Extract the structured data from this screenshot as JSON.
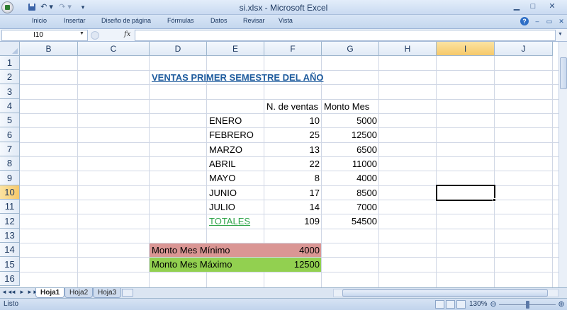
{
  "window": {
    "title": "si.xlsx - Microsoft Excel",
    "qat_undo": "↶ ▾",
    "qat_redo": "↷ ▾",
    "qat_more": "▾",
    "min": "▁",
    "max": "□",
    "close": "✕"
  },
  "ribbon": {
    "tabs": [
      "Inicio",
      "Insertar",
      "Diseño de página",
      "Fórmulas",
      "Datos",
      "Revisar",
      "Vista"
    ],
    "help": "?",
    "min": "–",
    "max": "▭",
    "close": "✕"
  },
  "formula_bar": {
    "name_box": "I10",
    "fx": "fx",
    "formula": ""
  },
  "sheet": {
    "columns": [
      "B",
      "C",
      "D",
      "E",
      "F",
      "G",
      "H",
      "I",
      "J"
    ],
    "selected_column": "I",
    "rows": [
      "1",
      "2",
      "3",
      "4",
      "5",
      "6",
      "7",
      "8",
      "9",
      "10",
      "11",
      "12",
      "13",
      "14",
      "15",
      "16"
    ],
    "selected_row": "10",
    "title": "VENTAS PRIMER SEMESTRE DEL AÑO",
    "headers": {
      "ventas": "N. de ventas",
      "monto": "Monto Mes"
    },
    "data": [
      {
        "mes": "ENERO",
        "ventas": "10",
        "monto": "5000"
      },
      {
        "mes": "FEBRERO",
        "ventas": "25",
        "monto": "12500"
      },
      {
        "mes": "MARZO",
        "ventas": "13",
        "monto": "6500"
      },
      {
        "mes": "ABRIL",
        "ventas": "22",
        "monto": "11000"
      },
      {
        "mes": "MAYO",
        "ventas": "8",
        "monto": "4000"
      },
      {
        "mes": "JUNIO",
        "ventas": "17",
        "monto": "8500"
      },
      {
        "mes": "JULIO",
        "ventas": "14",
        "monto": "7000"
      }
    ],
    "totals": {
      "label": "TOTALES",
      "ventas": "109",
      "monto": "54500"
    },
    "min": {
      "label": "Monto Mes Mínimo",
      "value": "4000"
    },
    "max": {
      "label": "Monto Mes Máximo",
      "value": "12500"
    }
  },
  "sheet_tabs": {
    "nav": [
      "◄◄",
      "◄",
      "►",
      "►►"
    ],
    "tabs": [
      "Hoja1",
      "Hoja2",
      "Hoja3"
    ],
    "active": "Hoja1"
  },
  "status": {
    "text": "Listo",
    "zoom": "130%",
    "zoom_out": "⊖",
    "zoom_in": "⊕",
    "zoom_fraction": 0.5
  },
  "colors": {
    "min_fill": "#da9694",
    "max_fill": "#92d050",
    "title": "#1f5c9e",
    "totales": "#2ea44a"
  }
}
